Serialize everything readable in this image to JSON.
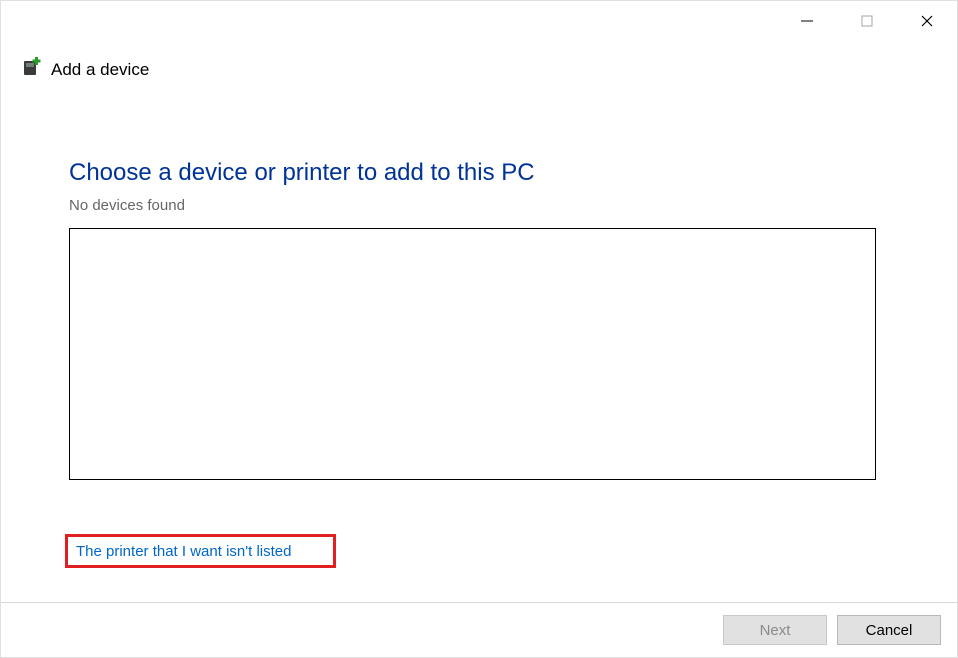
{
  "titlebar": {
    "minimize_icon": "minimize-icon",
    "maximize_icon": "maximize-icon",
    "close_icon": "close-icon"
  },
  "header": {
    "icon": "add-device-icon",
    "title": "Add a device"
  },
  "main": {
    "heading": "Choose a device or printer to add to this PC",
    "status": "No devices found",
    "devices": []
  },
  "link": {
    "label": "The printer that I want isn't listed"
  },
  "footer": {
    "next_label": "Next",
    "next_enabled": false,
    "cancel_label": "Cancel"
  },
  "highlighted_element": "printer-not-listed-link"
}
